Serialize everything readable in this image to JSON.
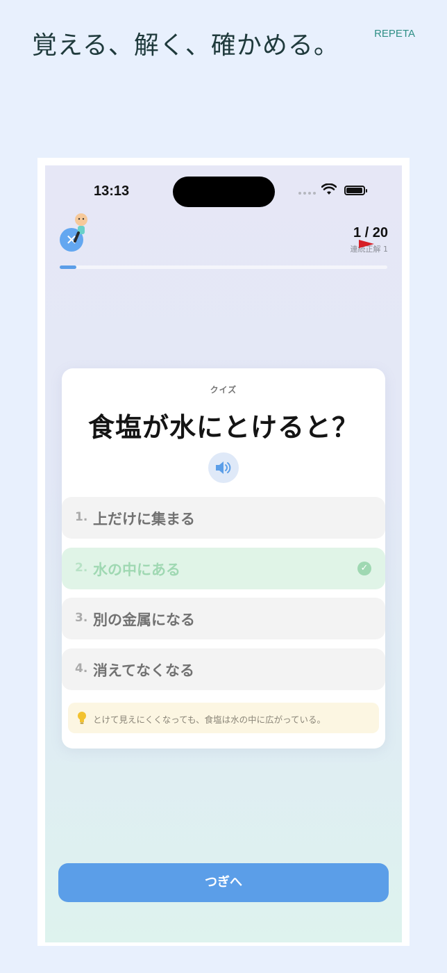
{
  "header": {
    "headline": "覚える、解く、確かめる。",
    "brand": "REPETA"
  },
  "status_bar": {
    "time": "13:13"
  },
  "quiz_header": {
    "counter": "1 / 20",
    "streak": "連続正解 1",
    "progress": 0.05,
    "close_icon": "close-icon"
  },
  "card": {
    "label": "クイズ",
    "question": "食塩が水にとけると？",
    "choices": [
      {
        "number": "1.",
        "text": "上だけに集まる",
        "state": "normal"
      },
      {
        "number": "2.",
        "text": "水の中にある",
        "state": "correct"
      },
      {
        "number": "3.",
        "text": "別の金属になる",
        "state": "normal"
      },
      {
        "number": "4.",
        "text": "消えてなくなる",
        "state": "normal"
      }
    ],
    "hint": "とけて見えにくくなっても、食塩は水の中に広がっている。"
  },
  "footer": {
    "next_label": "つぎへ"
  },
  "colors": {
    "accent": "#5b9ee8",
    "correct": "#9fd8b2",
    "brand": "#2f8f86"
  }
}
